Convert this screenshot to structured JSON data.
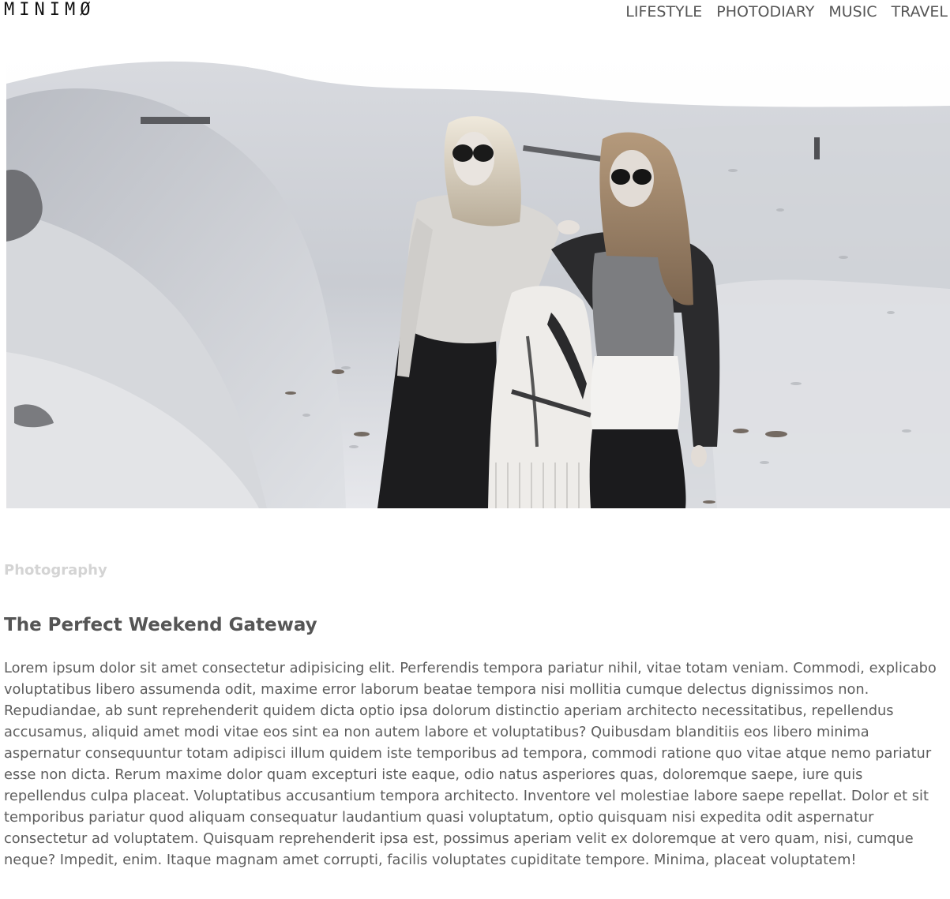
{
  "header": {
    "logo": "MINIMØ",
    "nav": [
      {
        "label": "LIFESTYLE"
      },
      {
        "label": "PHOTODIARY"
      },
      {
        "label": "MUSIC"
      },
      {
        "label": "TRAVEL"
      }
    ]
  },
  "hero": {
    "image": "black-and-white photo of two women in sunglasses on a sandy dune"
  },
  "post": {
    "category": "Photography",
    "title": "The Perfect Weekend Gateway",
    "body": "Lorem ipsum dolor sit amet consectetur adipisicing elit. Perferendis tempora pariatur nihil, vitae totam veniam. Commodi, explicabo voluptatibus libero assumenda odit, maxime error laborum beatae tempora nisi mollitia cumque delectus dignissimos non. Repudiandae, ab sunt reprehenderit quidem dicta optio ipsa dolorum distinctio aperiam architecto necessitatibus, repellendus accusamus, aliquid amet modi vitae eos sint ea non autem labore et voluptatibus? Quibusdam blanditiis eos libero minima aspernatur consequuntur totam adipisci illum quidem iste temporibus ad tempora, commodi ratione quo vitae atque nemo pariatur esse non dicta. Rerum maxime dolor quam excepturi iste eaque, odio natus asperiores quas, doloremque saepe, iure quis repellendus culpa placeat. Voluptatibus accusantium tempora architecto. Inventore vel molestiae labore saepe repellat. Dolor et sit temporibus pariatur quod aliquam consequatur laudantium quasi voluptatum, optio quisquam nisi expedita odit aspernatur consectetur ad voluptatem. Quisquam reprehenderit ipsa est, possimus aperiam velit ex doloremque at vero quam, nisi, cumque neque? Impedit, enim. Itaque magnam amet corrupti, facilis voluptates cupiditate tempore. Minima, placeat voluptatem!"
  }
}
